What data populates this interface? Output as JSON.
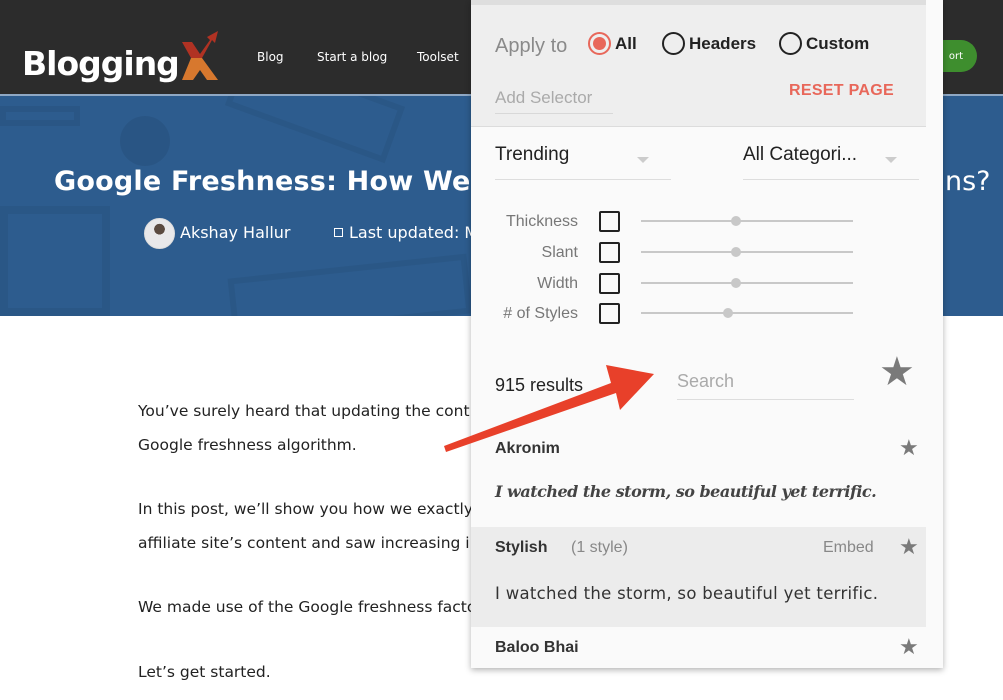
{
  "site": {
    "logo_text": "Blogging",
    "logo_x": "X",
    "nav": [
      "Blog",
      "Start a blog",
      "Toolset"
    ],
    "support_label_partial": "ort"
  },
  "hero": {
    "title": "Google Freshness: How We Boo",
    "title_end": "ns?",
    "author": "Akshay Hallur",
    "updated": "Last updated: M"
  },
  "article": {
    "lines": [
      "You’ve surely heard that updating the cont",
      "Google freshness algorithm.",
      "In this post, we’ll show you how we exactly",
      "affiliate site’s content and saw increasing i",
      "We made use of the Google freshness facto",
      "Let’s get started."
    ]
  },
  "panel": {
    "apply_to_label": "Apply to",
    "apply_options": [
      {
        "label": "All",
        "selected": true
      },
      {
        "label": "Headers",
        "selected": false
      },
      {
        "label": "Custom",
        "selected": false
      }
    ],
    "add_selector_placeholder": "Add Selector",
    "reset_label": "RESET PAGE",
    "sort_value": "Trending",
    "category_value": "All Categori...",
    "filters": [
      {
        "label": "Thickness",
        "checked": false,
        "value": 0.45
      },
      {
        "label": "Slant",
        "checked": false,
        "value": 0.45
      },
      {
        "label": "Width",
        "checked": false,
        "value": 0.45
      },
      {
        "label": "# of Styles",
        "checked": false,
        "value": 0.41
      }
    ],
    "results_count": "915 results",
    "search_placeholder": "Search",
    "fonts": [
      {
        "name": "Akronim",
        "styles": "",
        "embed": "",
        "sample": "I watched the storm, so beautiful yet terrific."
      },
      {
        "name": "Stylish",
        "styles": "(1 style)",
        "embed": "Embed",
        "sample": "I watched the storm, so beautiful yet terrific."
      },
      {
        "name": "Baloo Bhai",
        "styles": "",
        "embed": "",
        "sample": ""
      }
    ],
    "accent_color": "#e8675a"
  },
  "annotation": {
    "arrow_color": "#e8402a"
  }
}
